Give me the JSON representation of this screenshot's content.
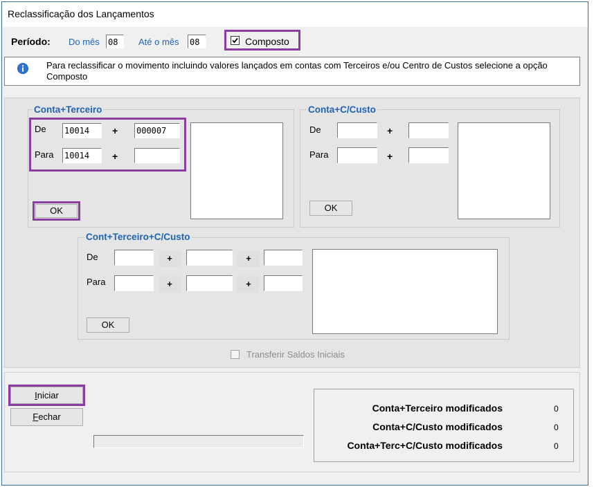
{
  "window": {
    "title": "Reclassificação dos Lançamentos"
  },
  "period": {
    "label": "Período:",
    "from_label": "Do mês",
    "from_value": "08",
    "to_label": "Até o mês",
    "to_value": "08",
    "composto_label": "Composto",
    "composto_checked": true
  },
  "info": {
    "text": "Para reclassificar o movimento incluindo valores lançados em contas com Terceiros e/ou Centro de Custos selecione a opção Composto"
  },
  "conta_terceiro": {
    "title": "Conta+Terceiro",
    "de_label": "De",
    "de_conta": "10014",
    "de_terceiro": "000007",
    "para_label": "Para",
    "para_conta": "10014",
    "para_terceiro": "",
    "plus": "+",
    "ok_label": "OK"
  },
  "conta_ccusto": {
    "title": "Conta+C/Custo",
    "de_label": "De",
    "para_label": "Para",
    "plus": "+",
    "ok_label": "OK"
  },
  "cont_terceiro_ccusto": {
    "title": "Cont+Terceiro+C/Custo",
    "de_label": "De",
    "para_label": "Para",
    "plus": "+",
    "ok_label": "OK"
  },
  "transferir": {
    "label": "Transferir Saldos Iniciais",
    "enabled": false
  },
  "buttons": {
    "iniciar": "Iniciar",
    "fechar": "Fechar"
  },
  "summary": [
    {
      "label": "Conta+Terceiro modificados",
      "value": "0"
    },
    {
      "label": "Conta+C/Custo modificados",
      "value": "0"
    },
    {
      "label": "Conta+Terc+C/Custo modificados",
      "value": "0"
    }
  ],
  "colors": {
    "accent_purple": "#8a3fa0",
    "label_blue": "#1f64b4",
    "info_icon": "#1e5fbf"
  }
}
